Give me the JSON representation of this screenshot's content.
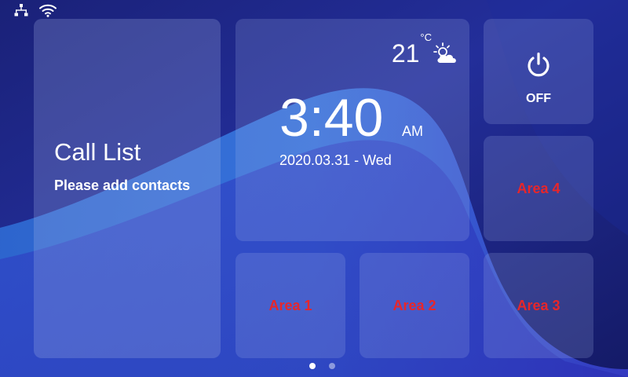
{
  "status_bar": {
    "icons": [
      "network-icon",
      "wifi-icon"
    ]
  },
  "call_list": {
    "title": "Call List",
    "subtitle": "Please add contacts"
  },
  "clock": {
    "temperature": "21",
    "temperature_unit": "°C",
    "weather_icon": "partly-cloudy-icon",
    "time": "3:40",
    "meridiem": "AM",
    "date": "2020.03.31 - Wed"
  },
  "power": {
    "icon": "power-icon",
    "label": "OFF"
  },
  "areas": [
    {
      "label": "Area 1"
    },
    {
      "label": "Area 2"
    },
    {
      "label": "Area 3"
    },
    {
      "label": "Area 4"
    }
  ],
  "pager": {
    "pages": 2,
    "active_page": 1
  },
  "colors": {
    "area_label": "#e8262a",
    "background_dark": "#121a5c",
    "background_accent": "#3b8fe0",
    "tile": "#aab9eb"
  }
}
